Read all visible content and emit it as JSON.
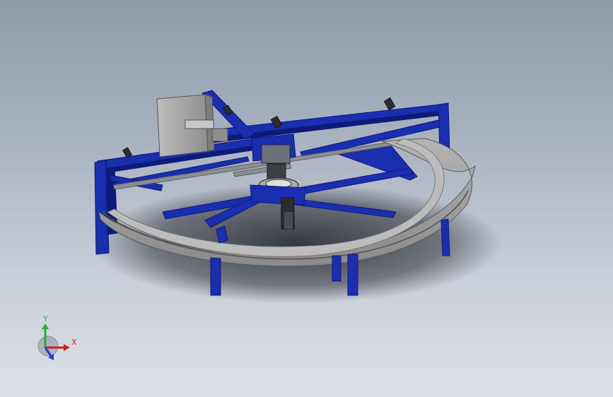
{
  "viewport": {
    "background_top": "#8f9aaa",
    "background_bottom": "#dde1e7"
  },
  "model": {
    "frame_color": "#1a2fb0",
    "frame_shadow": "#0d1a78",
    "tray_color": "#9a9a9a",
    "tray_edge": "#5a5a5a",
    "cabinet_color": "#a8a8a8",
    "floor_shadow": "#2a2e36"
  },
  "triad": {
    "x_label": "X",
    "y_label": "Y",
    "x_color": "#d21e1e",
    "y_color": "#1fae3a",
    "z_color": "#1f3fd2"
  }
}
